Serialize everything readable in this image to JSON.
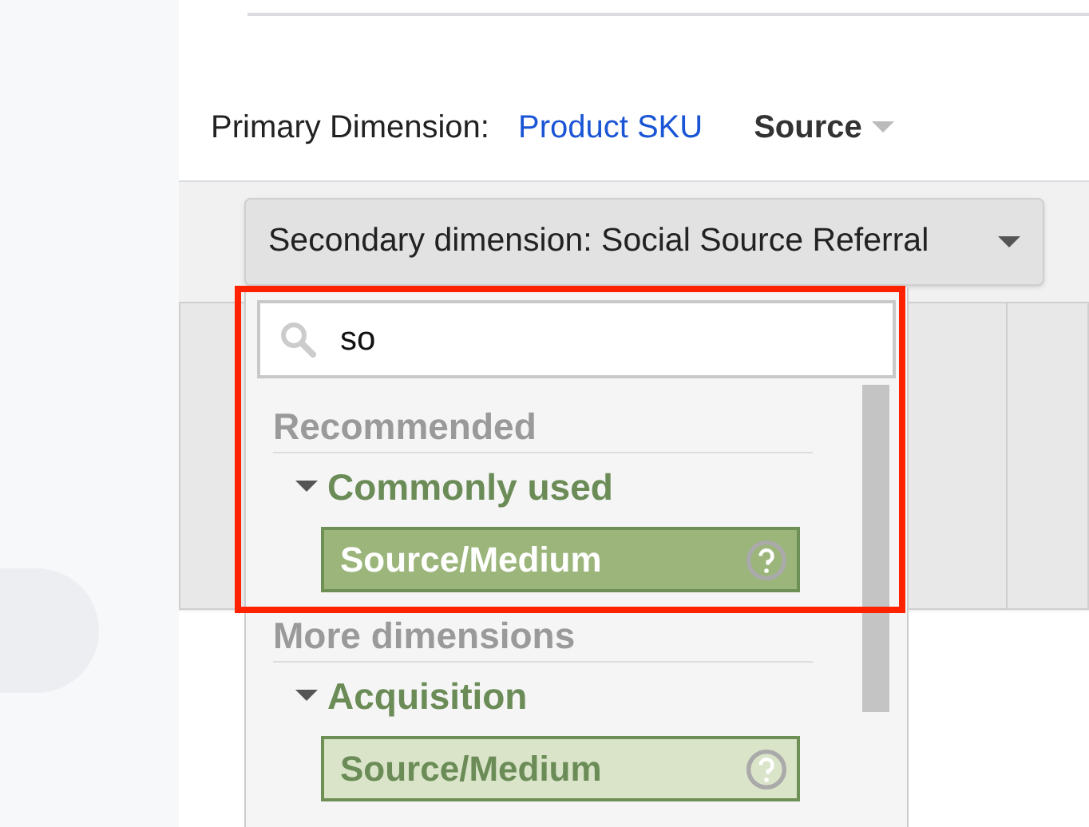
{
  "primary_dimension": {
    "label": "Primary Dimension:",
    "options": [
      {
        "label": "Product SKU",
        "selected": false
      },
      {
        "label": "Source",
        "selected": true
      }
    ]
  },
  "secondary_dimension": {
    "label": "Secondary dimension: Social Source Referral"
  },
  "dropdown": {
    "search": {
      "value": "so"
    },
    "sections": [
      {
        "heading": "Recommended",
        "groups": [
          {
            "label": "Commonly used",
            "expanded": true,
            "items": [
              {
                "label": "Source/Medium",
                "selected": true
              }
            ]
          }
        ]
      },
      {
        "heading": "More dimensions",
        "groups": [
          {
            "label": "Acquisition",
            "expanded": true,
            "items": [
              {
                "label": "Source/Medium",
                "selected": false
              }
            ]
          }
        ]
      }
    ]
  }
}
